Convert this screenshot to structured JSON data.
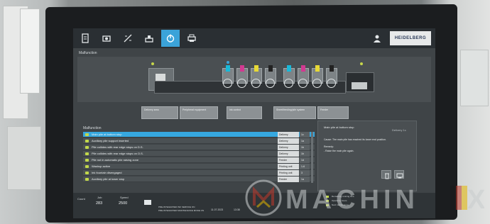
{
  "topbar": {
    "tabs": [
      {
        "icon": "document-icon"
      },
      {
        "icon": "camera-icon"
      },
      {
        "icon": "adjust-icon"
      },
      {
        "icon": "scale-icon"
      },
      {
        "icon": "power-icon",
        "active": true
      },
      {
        "icon": "printer-icon"
      }
    ],
    "brand": "HEIDELBERG",
    "accent": "#3ba3d9"
  },
  "malfunction_header": "Malfunction",
  "zones": [
    "Delivery area",
    "Peripheral equipment",
    "Ink control",
    "Sheet/feeding/pile system",
    "Feeder"
  ],
  "list_header": "Malfunction",
  "malfunctions": [
    {
      "text": "Main pile at bottom stop",
      "location": "Delivery",
      "code": "1c",
      "selected": true
    },
    {
      "text": "Auxiliary pile support inserted",
      "location": "Delivery",
      "code": "1a"
    },
    {
      "text": "Pile collides with rear edge stops on D.S.",
      "location": "Delivery",
      "code": "1b"
    },
    {
      "text": "Pile collides with rear edge stops on O.S.",
      "location": "Delivery",
      "code": "1b"
    },
    {
      "text": "Pile not in automatic pile raising zone",
      "location": "Feeder",
      "code": "1d"
    },
    {
      "text": "Washup active",
      "location": "Printing unit",
      "code": "1-6"
    },
    {
      "text": "Ink fountain disengaged",
      "location": "Printing unit",
      "code": "3"
    },
    {
      "text": "Auxiliary pile at lower stop",
      "location": "Feeder",
      "code": "1a"
    }
  ],
  "details": {
    "title": "Main pile at bottom stop",
    "ref": "Delivery 1c",
    "cause": "Cause: The main pile has reached its lower end position.",
    "remedy_label": "Remedy:",
    "remedy": "- Raise the main pile again."
  },
  "bottom": {
    "counter_label": "Count",
    "counter_sub": "Job",
    "job_value": "283",
    "speed_label": "Speed",
    "speed_value": "2500",
    "status_lines": [
      "PRE-INTEGRATED INK SERVICE ON",
      "PRE-INTEGRATED MAINTENANCE MODE ON"
    ],
    "date": "11.07.2023",
    "time": "13:38",
    "legend": [
      "Remaining running time",
      "Operating hours",
      "Next maintenance"
    ]
  }
}
